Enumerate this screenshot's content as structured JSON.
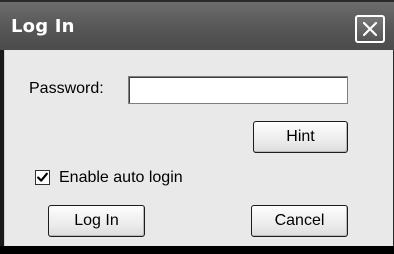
{
  "window": {
    "title": "Log In",
    "close_icon": "close-icon"
  },
  "form": {
    "password_label": "Password:",
    "password_value": "",
    "hint_label": "Hint",
    "auto_login_label": "Enable auto login",
    "auto_login_checked": true,
    "login_label": "Log In",
    "cancel_label": "Cancel"
  }
}
